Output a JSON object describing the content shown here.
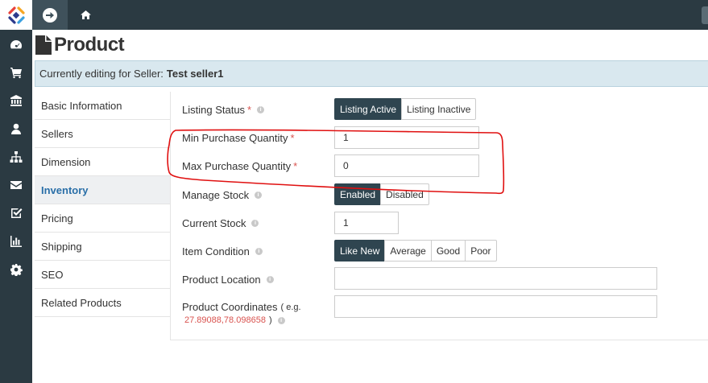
{
  "topbar": {
    "menu_icon": "arrow-circle-right-icon",
    "home_icon": "home-icon"
  },
  "rail": {
    "icons": [
      "dashboard-icon",
      "cart-icon",
      "bank-icon",
      "user-icon",
      "sitemap-icon",
      "envelope-icon",
      "check-square-icon",
      "bar-chart-icon",
      "gear-icon"
    ]
  },
  "page": {
    "title": "Product",
    "banner_prefix": "Currently editing for Seller:",
    "seller_name": "Test seller1"
  },
  "tabs": [
    {
      "label": "Basic Information",
      "active": false
    },
    {
      "label": "Sellers",
      "active": false
    },
    {
      "label": "Dimension",
      "active": false
    },
    {
      "label": "Inventory",
      "active": true
    },
    {
      "label": "Pricing",
      "active": false
    },
    {
      "label": "Shipping",
      "active": false
    },
    {
      "label": "SEO",
      "active": false
    },
    {
      "label": "Related Products",
      "active": false
    }
  ],
  "form": {
    "listing_status": {
      "label": "Listing Status",
      "required": "*",
      "options": [
        "Listing Active",
        "Listing Inactive"
      ],
      "selected": "Listing Active"
    },
    "min_purchase": {
      "label": "Min Purchase Quantity",
      "required": "*",
      "value": "1"
    },
    "max_purchase": {
      "label": "Max Purchase Quantity",
      "required": "*",
      "value": "0"
    },
    "manage_stock": {
      "label": "Manage Stock",
      "options": [
        "Enabled",
        "Disabled"
      ],
      "selected": "Enabled"
    },
    "current_stock": {
      "label": "Current Stock",
      "value": "1"
    },
    "item_condition": {
      "label": "Item Condition",
      "options": [
        "Like New",
        "Average",
        "Good",
        "Poor"
      ],
      "selected": "Like New"
    },
    "product_location": {
      "label": "Product Location",
      "value": ""
    },
    "product_coordinates": {
      "label": "Product Coordinates",
      "hint_open": "( e.g.",
      "hint_sample": "27.89088,78.098658",
      "hint_close": ")",
      "value": ""
    }
  },
  "annotation_color": "#e01010",
  "accent_color": "#2f4550"
}
